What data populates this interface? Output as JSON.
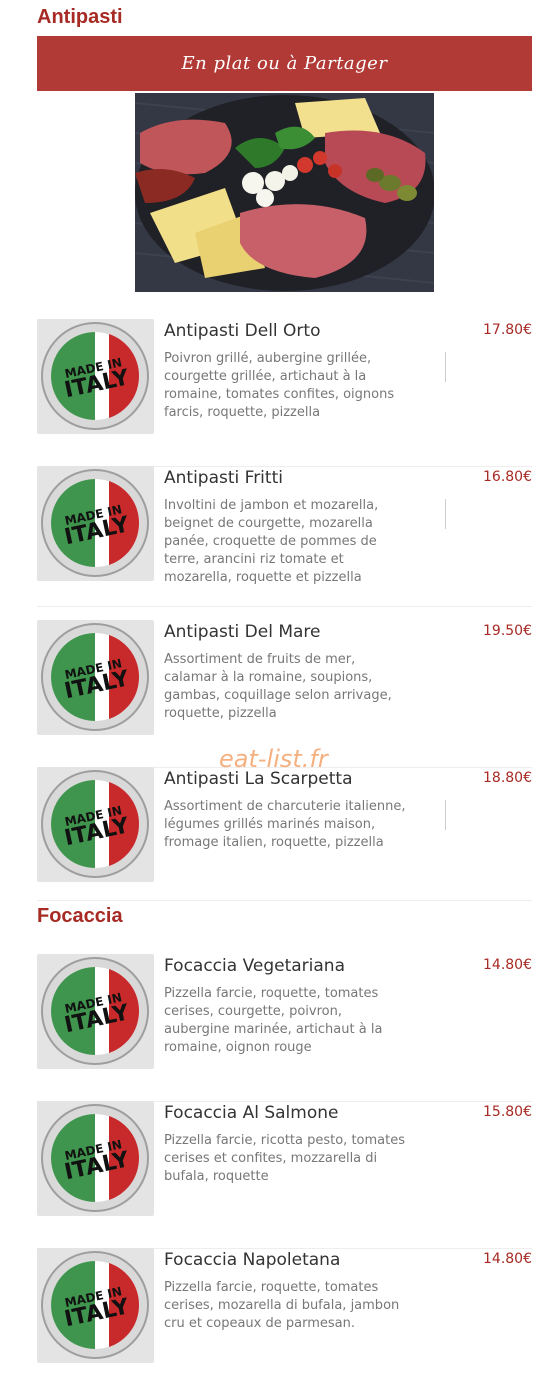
{
  "sections": [
    {
      "title": "Antipasti",
      "banner": "En plat ou à Partager",
      "items": [
        {
          "name": "Antipasti Dell Orto",
          "price": "17.80€",
          "desc": "Poivron grillé, aubergine grillée, courgette grillée, artichaut à la romaine, tomates confites, oignons farcis, roquette, pizzella"
        },
        {
          "name": "Antipasti Fritti",
          "price": "16.80€",
          "desc": "Involtini de jambon et mozarella, beignet de courgette, mozarella panée, croquette de pommes de terre, arancini riz tomate et mozarella, roquette et pizzella"
        },
        {
          "name": "Antipasti Del Mare",
          "price": "19.50€",
          "desc": "Assortiment de fruits de mer, calamar à la romaine, soupions, gambas, coquillage selon arrivage, roquette, pizzella"
        },
        {
          "name": "Antipasti La Scarpetta",
          "price": "18.80€",
          "desc": "Assortiment de charcuterie italienne, légumes grillés marinés maison, fromage italien, roquette, pizzella"
        }
      ]
    },
    {
      "title": "Focaccia",
      "items": [
        {
          "name": "Focaccia Vegetariana",
          "price": "14.80€",
          "desc": "Pizzella farcie, roquette, tomates cerises, courgette, poivron, aubergine marinée, artichaut à la romaine, oignon rouge"
        },
        {
          "name": "Focaccia Al Salmone",
          "price": "15.80€",
          "desc": "Pizzella farcie, ricotta pesto, tomates cerises et confites, mozzarella di bufala, roquette"
        },
        {
          "name": "Focaccia Napoletana",
          "price": "14.80€",
          "desc": "Pizzella farcie, roquette, tomates cerises, mozarella di bufala, jambon cru et copeaux de parmesan."
        }
      ]
    }
  ],
  "badge": {
    "line1": "MADE IN",
    "line2": "ITALY",
    "ring": "MADE IN ITALY"
  },
  "watermark": "eat-list.fr",
  "colors": {
    "accent": "#a72a24",
    "banner": "#b13a36",
    "green": "#2a8a3a",
    "red": "#c8292a"
  }
}
